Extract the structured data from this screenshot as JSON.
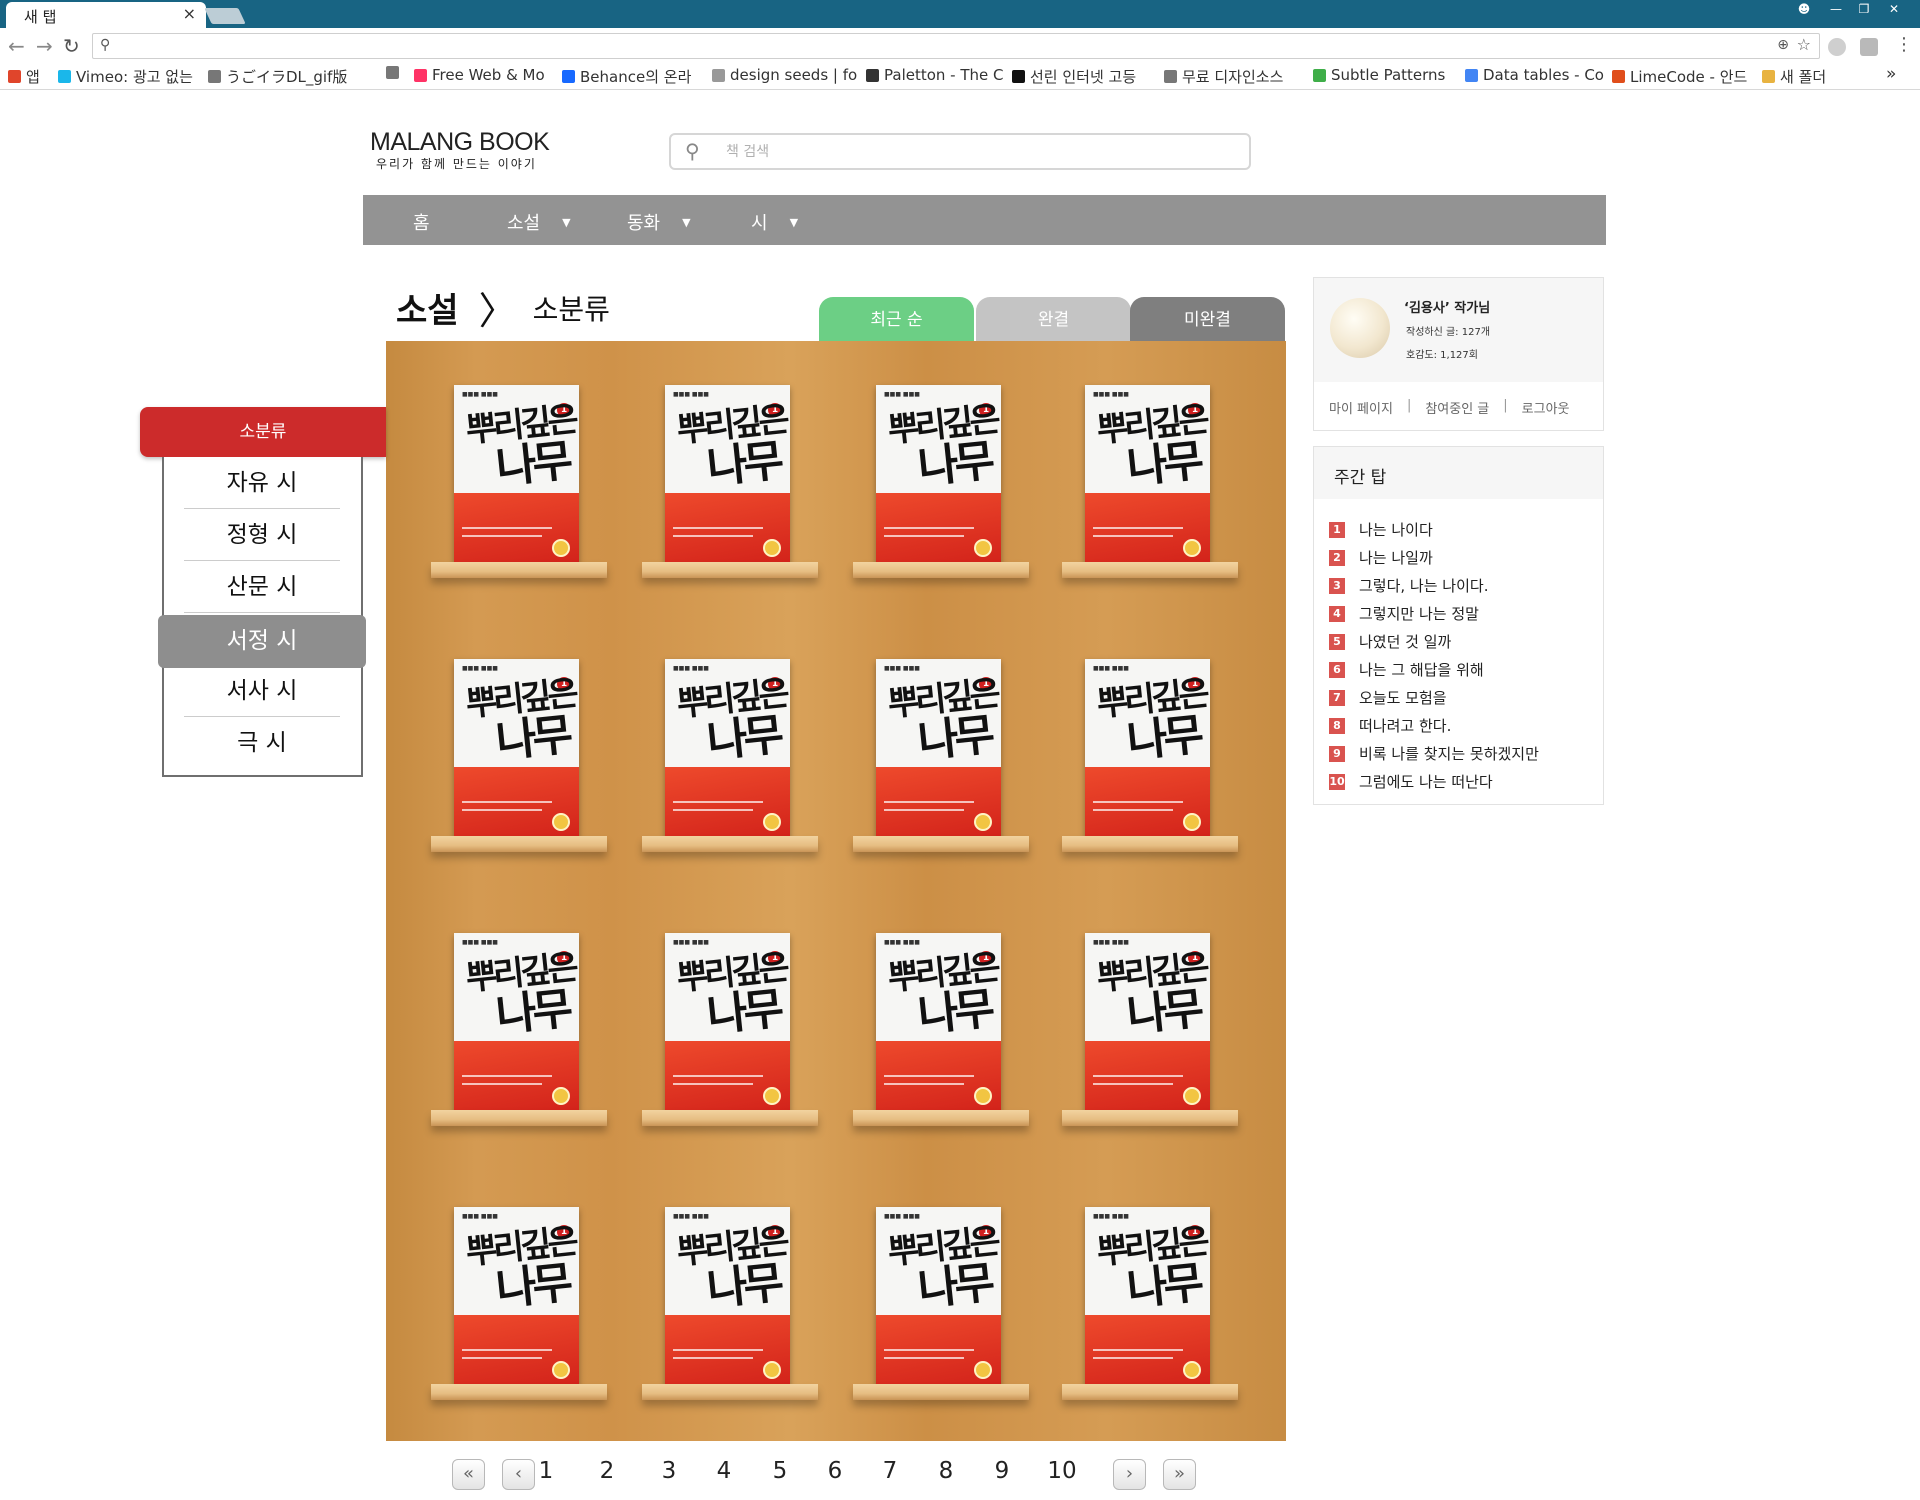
{
  "browser": {
    "tab_title": "새 탭",
    "tab_close": "×",
    "bookmarks": [
      {
        "label": "앱",
        "icon": "apps-grid-icon",
        "color": "#e0452b"
      },
      {
        "label": "Vimeo: 광고 없는",
        "icon": "vimeo-icon",
        "color": "#1ab7ea"
      },
      {
        "label": "うごイラDL_gif版",
        "icon": "page-icon",
        "color": "#777777"
      },
      {
        "label": "",
        "icon": "page-icon",
        "color": "#777777"
      },
      {
        "label": "Free Web & Mo",
        "icon": "invision-icon",
        "color": "#ff3366"
      },
      {
        "label": "Behance의 온라",
        "icon": "behance-icon",
        "color": "#1769ff"
      },
      {
        "label": "design seeds | fo",
        "icon": "designseeds-icon",
        "color": "#999999"
      },
      {
        "label": "Paletton - The C",
        "icon": "paletton-icon",
        "color": "#333333"
      },
      {
        "label": "선린 인터넷 고등",
        "icon": "school-icon",
        "color": "#111111"
      },
      {
        "label": "무료 디자인소스",
        "icon": "page-icon",
        "color": "#777777"
      },
      {
        "label": "Subtle Patterns",
        "icon": "subtlepatterns-icon",
        "color": "#3fae49"
      },
      {
        "label": "Data tables - Co",
        "icon": "google-icon",
        "color": "#4285f4"
      },
      {
        "label": "LimeCode - 안드",
        "icon": "limecode-icon",
        "color": "#e04e1b"
      },
      {
        "label": "새 폴더",
        "icon": "folder-icon",
        "color": "#e8b341"
      }
    ],
    "more": "»"
  },
  "header": {
    "logo_main": "MALANG BOOK",
    "logo_sub": "우리가 함께 만드는 이야기",
    "search_placeholder": "책 검색"
  },
  "nav": {
    "items": [
      {
        "label": "홈",
        "has_dropdown": false
      },
      {
        "label": "소설",
        "has_dropdown": true
      },
      {
        "label": "동화",
        "has_dropdown": true
      },
      {
        "label": "시",
        "has_dropdown": true
      }
    ]
  },
  "breadcrumb": {
    "category": "소설",
    "separator": "〉",
    "sub": "소분류"
  },
  "filter_tabs": [
    {
      "label": "최근 순",
      "color": "#6ccf85"
    },
    {
      "label": "완결",
      "color": "#c4c4c4"
    },
    {
      "label": "미완결",
      "color": "#7f7f7f"
    }
  ],
  "sidebar": {
    "header": "소분류",
    "items": [
      "자유 시",
      "정형 시",
      "산문 시",
      "서정 시",
      "서사 시",
      "극 시"
    ],
    "active_index": 3
  },
  "book": {
    "title_line1": "뿌리깊은",
    "title_line2": "나무",
    "series_badge": "1",
    "count": 16
  },
  "user": {
    "name": "‘김용사’ 작가님",
    "posts": "작성하신 글: 127개",
    "favor": "호감도: 1,127회",
    "links": [
      "마이 페이지",
      "참여중인 글",
      "로그아웃"
    ],
    "link_sep": "|"
  },
  "weekly": {
    "title": "주간 탑",
    "items": [
      "나는 나이다",
      "나는 나일까",
      "그렇다, 나는 나이다.",
      "그렇지만 나는 정말",
      "나였던 것 일까",
      "나는 그 해답을 위해",
      "오늘도 모험을",
      "떠나려고 한다.",
      "비록 나를 찾지는 못하겠지만",
      "그럼에도 나는 떠난다"
    ]
  },
  "pagination": {
    "first": "«",
    "prev": "‹",
    "pages": [
      "1",
      "2",
      "3",
      "4",
      "5",
      "6",
      "7",
      "8",
      "9",
      "10"
    ],
    "next": "›",
    "last": "»"
  }
}
